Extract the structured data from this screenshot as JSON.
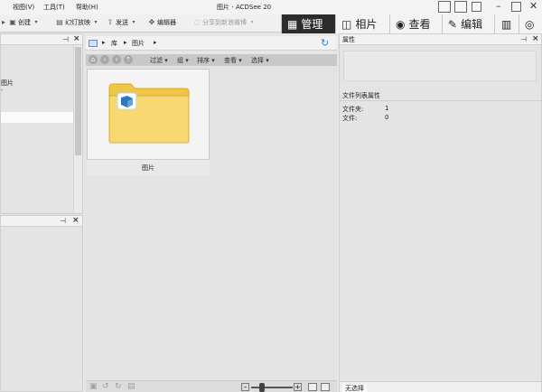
{
  "window": {
    "title": "图片 - ACDSee 20",
    "menu": [
      "视图(V)",
      "工具(T)",
      "帮助(H)"
    ]
  },
  "toolbar": {
    "items": [
      {
        "label": "创建",
        "icon": "create-icon"
      },
      {
        "label": "幻灯放映",
        "icon": "slideshow-icon"
      },
      {
        "label": "发送",
        "icon": "send-icon"
      },
      {
        "label": "编辑器",
        "icon": "editor-icon"
      },
      {
        "label": "分享到新浪微博",
        "icon": "weibo-share-icon",
        "disabled": true
      }
    ]
  },
  "modes": [
    {
      "label": "管理",
      "icon": "grid-icon",
      "active": true
    },
    {
      "label": "相片",
      "icon": "photos-icon"
    },
    {
      "label": "查看",
      "icon": "eye-icon"
    },
    {
      "label": "编辑",
      "icon": "edit-icon"
    }
  ],
  "left_panel": {
    "items": [
      "图片",
      "片"
    ]
  },
  "breadcrumb": {
    "items": [
      "库",
      "图片"
    ]
  },
  "filterbar": {
    "items": [
      "过滤",
      "组",
      "排序",
      "查看",
      "选择"
    ]
  },
  "thumbnail": {
    "label": "图片"
  },
  "properties": {
    "title": "属性",
    "section_title": "文件列表属性",
    "rows": [
      {
        "label": "文件夹:",
        "value": "1"
      },
      {
        "label": "文件:",
        "value": "0"
      }
    ],
    "status": "无选择"
  },
  "colors": {
    "active_mode_bg": "#2c2c2c",
    "folder_yellow": "#f3cf5d",
    "folder_badge": "#2a78c2"
  }
}
